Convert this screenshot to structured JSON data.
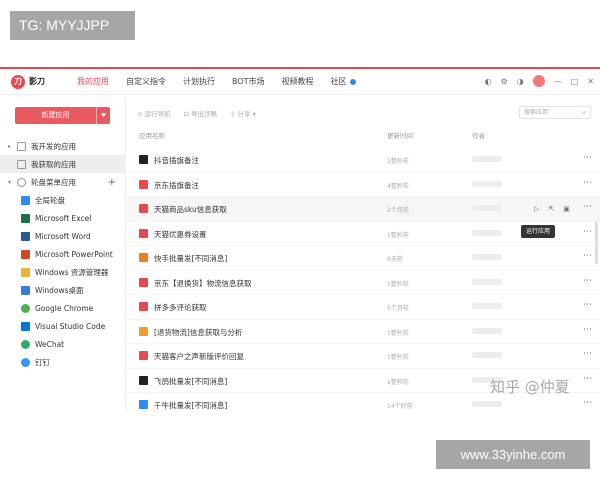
{
  "overlay": {
    "top_tag": "TG: MYYJJPP",
    "bottom_tag": "www.33yinhe.com",
    "watermark": "知乎 @仲夏"
  },
  "app": {
    "logo_text": "影刀",
    "nav": [
      {
        "label": "我的应用",
        "active": true
      },
      {
        "label": "自定义指令"
      },
      {
        "label": "计划执行"
      },
      {
        "label": "BOT市场"
      },
      {
        "label": "视频教程"
      },
      {
        "label": "社区"
      }
    ]
  },
  "sidebar": {
    "new_button": "新建应用",
    "items": [
      {
        "label": "我开发的应用",
        "caret": "▸"
      },
      {
        "label": "我获取的应用",
        "selected": true
      },
      {
        "label": "轮盘菜单应用",
        "caret": "▾"
      },
      {
        "label": "全局轮盘",
        "color": "#2d8cf0"
      },
      {
        "label": "Microsoft Excel",
        "color": "#1e7145"
      },
      {
        "label": "Microsoft Word",
        "color": "#2b5797"
      },
      {
        "label": "Microsoft PowerPoint",
        "color": "#d24726"
      },
      {
        "label": "Windows 资源管理器",
        "color": "#e8b339"
      },
      {
        "label": "Windows桌面",
        "color": "#3a7bd5"
      },
      {
        "label": "Google Chrome",
        "color": "#4caf50"
      },
      {
        "label": "Visual Studio Code",
        "color": "#0078d4"
      },
      {
        "label": "WeChat",
        "color": "#2aae67"
      },
      {
        "label": "钉钉",
        "color": "#3296fa"
      }
    ]
  },
  "main": {
    "toolbar": [
      "运行导航",
      "导出涉略",
      "分享"
    ],
    "search_placeholder": "搜索应用",
    "columns": {
      "name": "应用名称",
      "time": "更新时间",
      "author": "作者"
    },
    "tooltip": "运行应用",
    "rows": [
      {
        "name": "抖音插旗备注",
        "time": "1整秒前",
        "color": "#222222"
      },
      {
        "name": "京东插旗备注",
        "time": "4整秒前",
        "color": "#e8484e"
      },
      {
        "name": "天猫商品sku信息获取",
        "time": "2个月前",
        "color": "#e8484e",
        "highlight": true
      },
      {
        "name": "天猫优惠券设置",
        "time": "1整秒前",
        "color": "#e8484e"
      },
      {
        "name": "快手批量发[不同消息]",
        "time": "6天前",
        "color": "#f07c1a"
      },
      {
        "name": "京东【退换货】物流信息获取",
        "time": "1整秒前",
        "color": "#e8484e"
      },
      {
        "name": "拼多多评论获取",
        "time": "5个月前",
        "color": "#e8484e"
      },
      {
        "name": "[退货物流]信息获取与分析",
        "time": "1整秒前",
        "color": "#f0a020"
      },
      {
        "name": "天猫客户之声新版评价回复",
        "time": "1整秒前",
        "color": "#e8484e"
      },
      {
        "name": "飞鸽批量发[不同消息]",
        "time": "1整秒前",
        "color": "#222222"
      },
      {
        "name": "千牛批量发[不同消息]",
        "time": "14个好前",
        "color": "#2d8cf0"
      }
    ]
  }
}
